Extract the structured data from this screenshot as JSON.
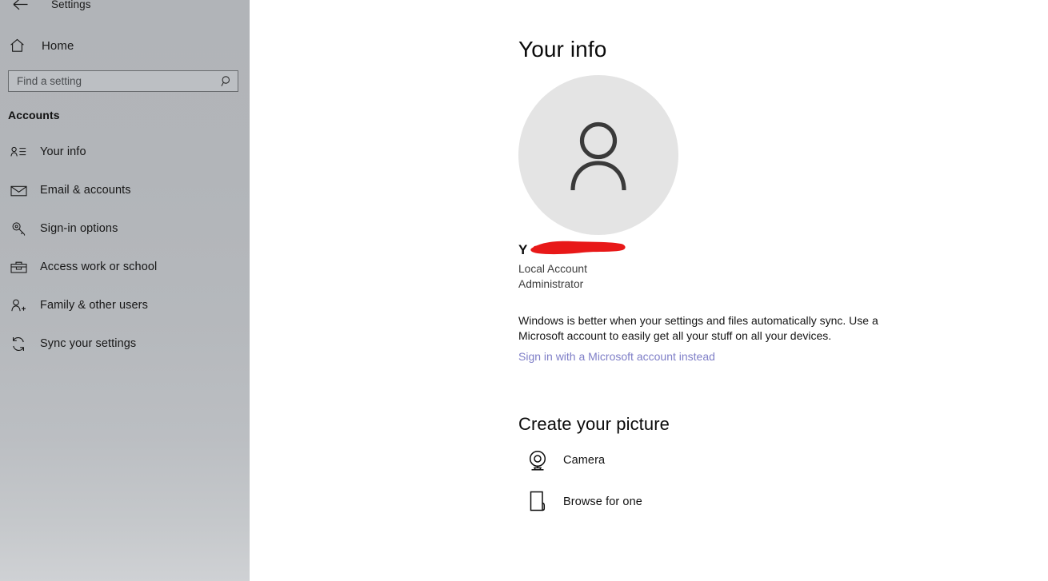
{
  "window": {
    "title": "Settings",
    "back_icon": "back-arrow-icon"
  },
  "sidebar": {
    "home": {
      "label": "Home",
      "icon": "home-icon"
    },
    "search": {
      "placeholder": "Find a setting",
      "value": "",
      "icon": "search-icon"
    },
    "section_label": "Accounts",
    "items": [
      {
        "label": "Your info",
        "icon": "contact-card-icon"
      },
      {
        "label": "Email & accounts",
        "icon": "mail-icon"
      },
      {
        "label": "Sign-in options",
        "icon": "key-icon"
      },
      {
        "label": "Access work or school",
        "icon": "briefcase-icon"
      },
      {
        "label": "Family & other users",
        "icon": "add-user-icon"
      },
      {
        "label": "Sync your settings",
        "icon": "sync-icon"
      }
    ]
  },
  "main": {
    "page_title": "Your info",
    "avatar": {
      "icon": "person-avatar-icon",
      "bg_color": "#e4e4e4",
      "glyph_color": "#3a3a3a"
    },
    "user": {
      "name_visible": "Y",
      "redacted": true,
      "redaction_color": "#e81818",
      "account_type": "Local Account",
      "role": "Administrator"
    },
    "sync_description": "Windows is better when your settings and files automatically sync. Use a Microsoft account to easily get all your stuff on all your devices.",
    "microsoft_link": {
      "label": "Sign in with a Microsoft account instead",
      "color": "#7e7ec7"
    },
    "create_picture": {
      "title": "Create your picture",
      "options": [
        {
          "label": "Camera",
          "icon": "webcam-icon"
        },
        {
          "label": "Browse for one",
          "icon": "file-page-icon"
        }
      ]
    }
  }
}
